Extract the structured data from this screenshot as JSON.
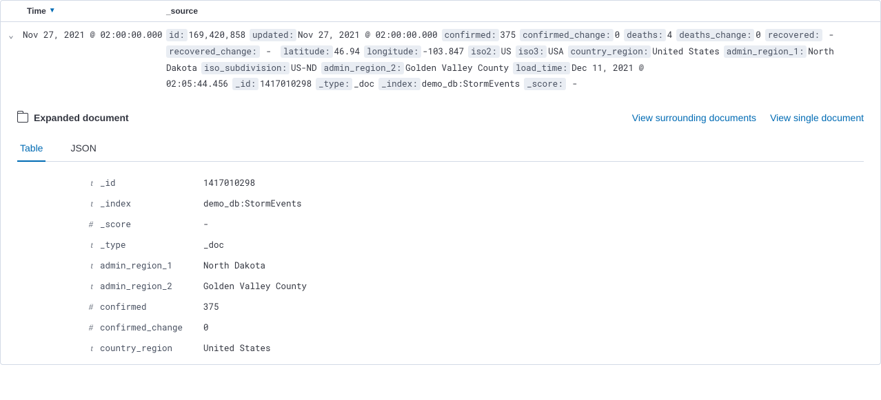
{
  "columns": {
    "time": "Time",
    "source": "_source"
  },
  "row": {
    "time": "Nov 27, 2021 @ 02:00:00.000",
    "source_pairs": [
      {
        "k": "id:",
        "v": "169,420,858"
      },
      {
        "k": "updated:",
        "v": "Nov 27, 2021 @ 02:00:00.000"
      },
      {
        "k": "confirmed:",
        "v": "375"
      },
      {
        "k": "confirmed_change:",
        "v": "0"
      },
      {
        "k": "deaths:",
        "v": "4"
      },
      {
        "k": "deaths_change:",
        "v": "0"
      },
      {
        "k": "recovered:",
        "v": " - "
      },
      {
        "k": "recovered_change:",
        "v": " - "
      },
      {
        "k": "latitude:",
        "v": "46.94"
      },
      {
        "k": "longitude:",
        "v": "-103.847"
      },
      {
        "k": "iso2:",
        "v": "US"
      },
      {
        "k": "iso3:",
        "v": "USA"
      },
      {
        "k": "country_region:",
        "v": "United States"
      },
      {
        "k": "admin_region_1:",
        "v": "North Dakota"
      },
      {
        "k": "iso_subdivision:",
        "v": "US-ND"
      },
      {
        "k": "admin_region_2:",
        "v": "Golden Valley County"
      },
      {
        "k": "load_time:",
        "v": "Dec 11, 2021 @ 02:05:44.456"
      },
      {
        "k": "_id:",
        "v": "1417010298"
      },
      {
        "k": "_type:",
        "v": "_doc"
      },
      {
        "k": "_index:",
        "v": "demo_db:StormEvents"
      },
      {
        "k": "_score:",
        "v": " - "
      }
    ]
  },
  "expanded": {
    "title": "Expanded document",
    "links": {
      "surrounding": "View surrounding documents",
      "single": "View single document"
    },
    "tabs": {
      "table": "Table",
      "json": "JSON"
    },
    "fields": [
      {
        "type": "t",
        "name": "_id",
        "value": "1417010298"
      },
      {
        "type": "t",
        "name": "_index",
        "value": "demo_db:StormEvents"
      },
      {
        "type": "#",
        "name": "_score",
        "value": " - "
      },
      {
        "type": "t",
        "name": "_type",
        "value": "_doc"
      },
      {
        "type": "t",
        "name": "admin_region_1",
        "value": "North Dakota"
      },
      {
        "type": "t",
        "name": "admin_region_2",
        "value": "Golden Valley County"
      },
      {
        "type": "#",
        "name": "confirmed",
        "value": "375"
      },
      {
        "type": "#",
        "name": "confirmed_change",
        "value": "0"
      },
      {
        "type": "t",
        "name": "country_region",
        "value": "United States"
      }
    ]
  }
}
